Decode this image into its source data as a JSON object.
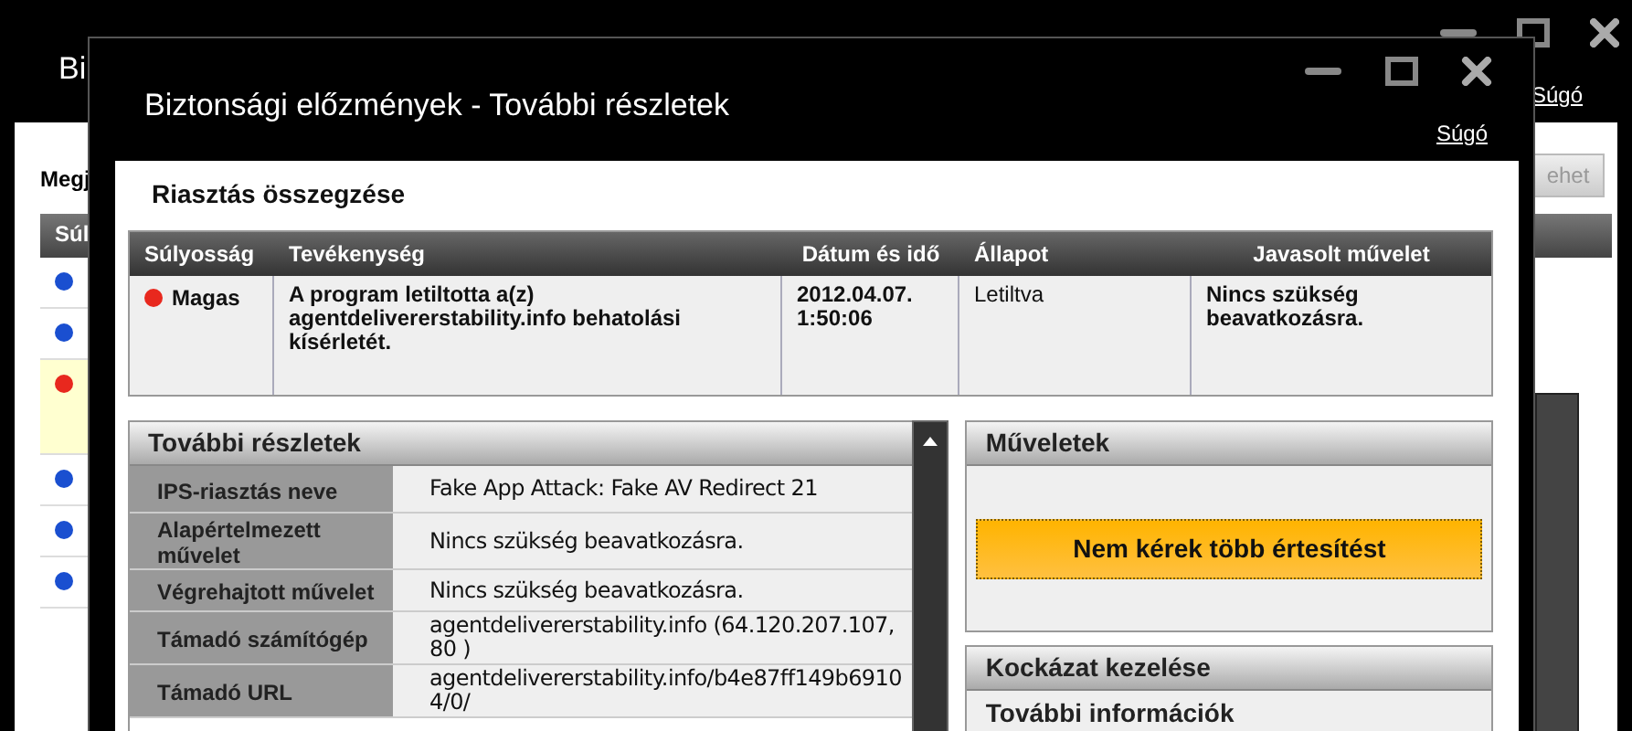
{
  "background_window": {
    "title": "Bi",
    "help": "Súgó",
    "label": "Megj",
    "button": "ehet",
    "column": "Súl",
    "rows": [
      {
        "color": "#1a4fd0",
        "selected": false
      },
      {
        "color": "#1a4fd0",
        "selected": false
      },
      {
        "color": "#e8281e",
        "selected": true
      },
      {
        "color": "#1a4fd0",
        "selected": false
      },
      {
        "color": "#1a4fd0",
        "selected": false
      },
      {
        "color": "#1a4fd0",
        "selected": false
      }
    ]
  },
  "dialog": {
    "title": "Biztonsági előzmények - További részletek",
    "help": "Súgó",
    "summary": {
      "heading": "Riasztás összegzése",
      "columns": [
        "Súlyosság",
        "Tevékenység",
        "Dátum és idő",
        "Állapot",
        "Javasolt művelet"
      ],
      "rows": [
        {
          "severity": "Magas",
          "color": "#e8281e",
          "activity": "A program letiltotta a(z) agentdelivererstability.info behatolási kísérletét.",
          "datetime": "2012.04.07. 1:50:06",
          "status": "Letiltva",
          "recommended": "Nincs szükség beavatkozásra."
        }
      ]
    },
    "details": {
      "heading": "További részletek",
      "rows": [
        {
          "label": "IPS-riasztás neve",
          "value": "Fake App Attack: Fake AV Redirect 21"
        },
        {
          "label": "Alapértelmezett művelet",
          "value": "Nincs szükség beavatkozásra."
        },
        {
          "label": "Végrehajtott művelet",
          "value": "Nincs szükség beavatkozásra."
        },
        {
          "label": "Támadó számítógép",
          "value": "agentdelivererstability.info (64.120.207.107, 80 )"
        },
        {
          "label": "Támadó URL",
          "value": "agentdelivererstability.info/b4e87ff149b69104/0/"
        }
      ]
    },
    "actions": {
      "heading": "Műveletek",
      "button": "Nem kérek több értesítést"
    },
    "risk": {
      "heading": "Kockázat kezelése",
      "item": "További információk"
    }
  }
}
